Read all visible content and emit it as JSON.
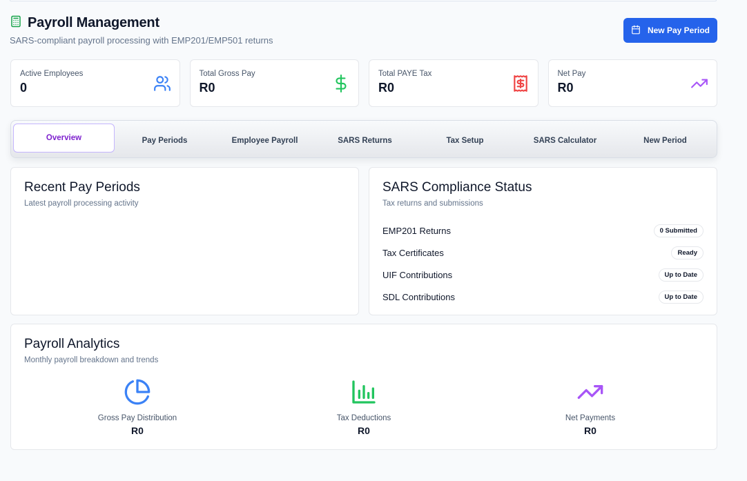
{
  "header": {
    "title": "Payroll Management",
    "subtitle": "SARS-compliant payroll processing with EMP201/EMP501 returns",
    "new_period_button": "New Pay Period",
    "title_icon": "calculator-icon"
  },
  "stats": [
    {
      "label": "Active Employees",
      "value": "0",
      "icon": "users-icon",
      "color": "#3b82f6"
    },
    {
      "label": "Total Gross Pay",
      "value": "R0",
      "icon": "dollar-icon",
      "color": "#22c55e"
    },
    {
      "label": "Total PAYE Tax",
      "value": "R0",
      "icon": "receipt-icon",
      "color": "#ef4444"
    },
    {
      "label": "Net Pay",
      "value": "R0",
      "icon": "trending-up-icon",
      "color": "#a855f7"
    }
  ],
  "tabs": [
    "Overview",
    "Pay Periods",
    "Employee Payroll",
    "SARS Returns",
    "Tax Setup",
    "SARS Calculator",
    "New Period"
  ],
  "recent": {
    "title": "Recent Pay Periods",
    "subtitle": "Latest payroll processing activity"
  },
  "sars": {
    "title": "SARS Compliance Status",
    "subtitle": "Tax returns and submissions",
    "items": [
      {
        "label": "EMP201 Returns",
        "status": "0 Submitted"
      },
      {
        "label": "Tax Certificates",
        "status": "Ready"
      },
      {
        "label": "UIF Contributions",
        "status": "Up to Date"
      },
      {
        "label": "SDL Contributions",
        "status": "Up to Date"
      }
    ]
  },
  "analytics": {
    "title": "Payroll Analytics",
    "subtitle": "Monthly payroll breakdown and trends",
    "metrics": [
      {
        "label": "Gross Pay Distribution",
        "value": "R0",
        "icon": "pie-chart-icon",
        "color": "#3b82f6"
      },
      {
        "label": "Tax Deductions",
        "value": "R0",
        "icon": "bar-chart-icon",
        "color": "#22c55e"
      },
      {
        "label": "Net Payments",
        "value": "R0",
        "icon": "trending-up-icon",
        "color": "#a855f7"
      }
    ]
  },
  "colors": {
    "primary": "#2563eb",
    "accent_purple": "#7e22ce"
  }
}
